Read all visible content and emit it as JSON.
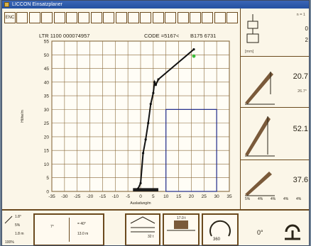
{
  "window": {
    "title": "LICCON Einsatzplaner"
  },
  "toolbar": {
    "buttons": [
      "ENC",
      "",
      "",
      "",
      "",
      "",
      "",
      "",
      "",
      "",
      "",
      "",
      "",
      "",
      "",
      "",
      "",
      "",
      ""
    ]
  },
  "header": {
    "left": "LTR 1100  000074957",
    "code": "CODE =5167<",
    "code2": "B175 6731"
  },
  "chart_data": {
    "type": "line",
    "ylabel": "Höhe/m",
    "xlabel": "Ausladung/m",
    "xlim": [
      -35,
      35
    ],
    "ylim": [
      0,
      55
    ],
    "x_ticks": [
      -35,
      -30,
      -25,
      -20,
      -15,
      -10,
      -5,
      0,
      5,
      10,
      15,
      20,
      25,
      30,
      35
    ],
    "y_ticks": [
      0,
      5,
      10,
      15,
      20,
      25,
      30,
      35,
      40,
      45,
      50,
      55
    ],
    "series": [
      {
        "values": [
          [
            -1,
            1
          ],
          [
            0,
            3
          ],
          [
            1,
            14
          ],
          [
            2,
            19
          ],
          [
            3,
            25
          ],
          [
            4,
            32
          ],
          [
            5,
            36
          ],
          [
            5.5,
            40
          ],
          [
            6,
            39
          ],
          [
            7,
            41
          ],
          [
            21,
            52
          ]
        ]
      }
    ],
    "marker_green": [
      21,
      49.5
    ],
    "load_box": {
      "x": [
        10,
        30
      ],
      "y": [
        0,
        30
      ]
    },
    "crane_x": [
      -3,
      7
    ]
  },
  "right": {
    "top_small_left": "n = 1",
    "top_val1": "0",
    "top_val2": "2",
    "mt_label": "[mm]",
    "panel1_val": "20.7",
    "panel1_sub": "26.7°",
    "panel2_val": "52.1",
    "panel3_val": "37.6",
    "panel3_ticks": [
      "5%",
      "4%",
      "4%",
      "4%",
      "4%"
    ]
  },
  "bottom": {
    "b1": [
      "1.8°",
      "5%",
      "1.8 m",
      "100%"
    ],
    "b2": [
      "7°",
      "= 40°",
      "13.0 m"
    ],
    "b3_val": "32 t",
    "b4_val": "17.0 t",
    "b5_val": "360",
    "b6_val": "0°"
  }
}
